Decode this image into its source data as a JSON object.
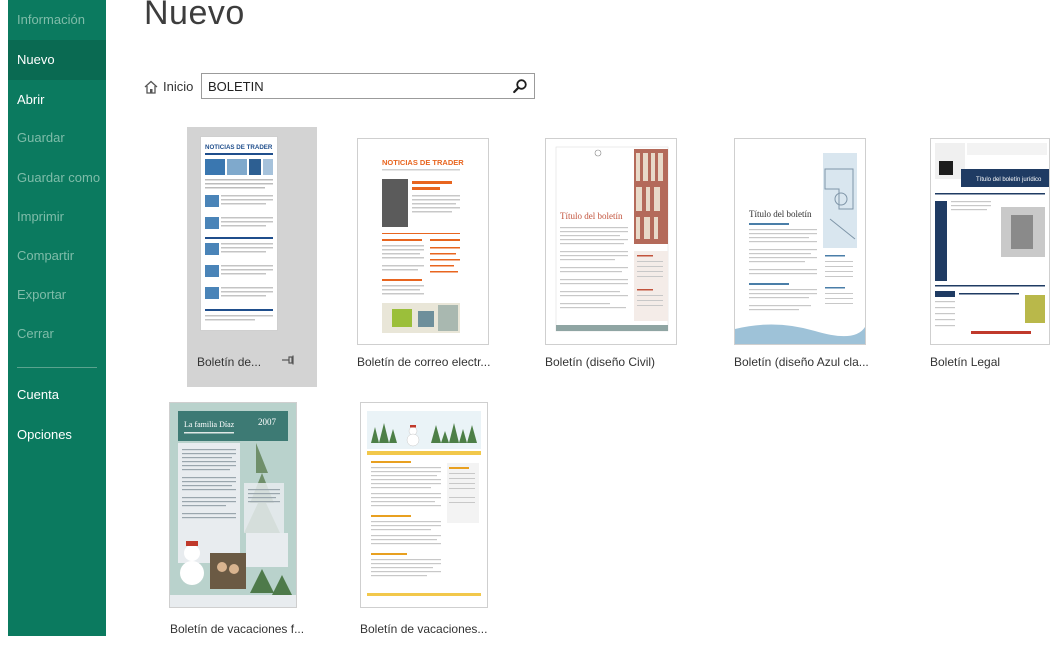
{
  "sidebar": {
    "items": [
      {
        "label": "Información"
      },
      {
        "label": "Nuevo"
      },
      {
        "label": "Abrir"
      },
      {
        "label": "Guardar"
      },
      {
        "label": "Guardar como"
      },
      {
        "label": "Imprimir"
      },
      {
        "label": "Compartir"
      },
      {
        "label": "Exportar"
      },
      {
        "label": "Cerrar"
      },
      {
        "label": "Cuenta"
      },
      {
        "label": "Opciones"
      }
    ],
    "active": "Nuevo",
    "colors": {
      "background": "#0b7a5f",
      "active": "#0a6a52",
      "disabled_text": "#7fbca9"
    }
  },
  "header": {
    "title": "Nuevo",
    "home_label": "Inicio"
  },
  "search": {
    "value": "BOLETIN"
  },
  "templates": [
    {
      "label": "Boletín de...",
      "selected": true,
      "thumb_text": {
        "headline": "NOTICIAS DE TRADER"
      }
    },
    {
      "label": "Boletín de correo electr...",
      "thumb_text": {
        "headline": "NOTICIAS DE TRADER"
      }
    },
    {
      "label": "Boletín (diseño Civil)",
      "thumb_text": {
        "headline": "Título del boletín"
      }
    },
    {
      "label": "Boletín (diseño Azul cla...",
      "thumb_text": {
        "headline": "Título del boletín"
      }
    },
    {
      "label": "Boletín Legal",
      "thumb_text": {
        "headline": "Título del boletín jurídico"
      }
    },
    {
      "label": "Boletín de vacaciones f...",
      "thumb_text": {
        "headline": "La familia Díaz",
        "year": "2007"
      }
    },
    {
      "label": "Boletín de vacaciones...",
      "thumb_text": {}
    }
  ]
}
